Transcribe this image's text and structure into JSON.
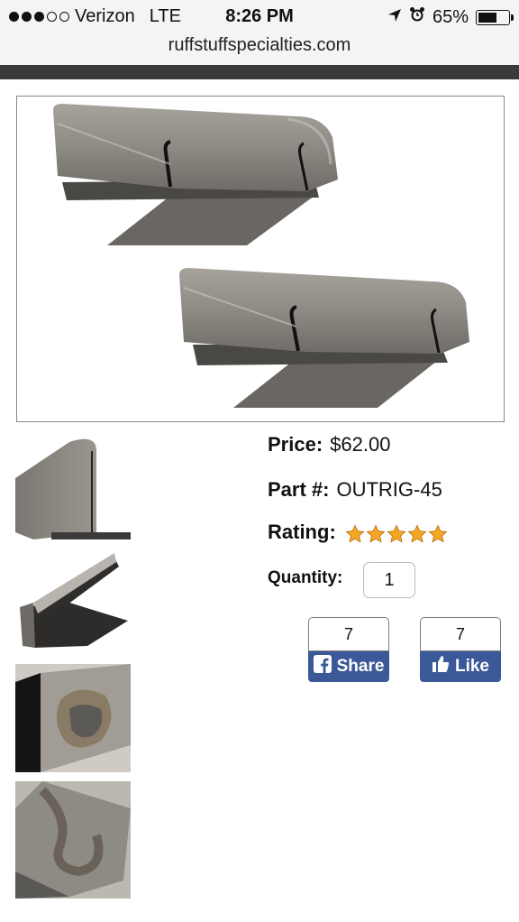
{
  "status_bar": {
    "carrier": "Verizon",
    "network": "LTE",
    "time": "8:26 PM",
    "battery": "65%",
    "battery_level": 0.65,
    "signal_bars_filled": 3,
    "signal_bars_total": 5,
    "icons": [
      "location-arrow-icon",
      "alarm-clock-icon",
      "battery-icon"
    ]
  },
  "browser": {
    "url": "ruffstuffspecialties.com"
  },
  "product": {
    "price_label": "Price:",
    "price_value": "$62.00",
    "part_label": "Part #:",
    "part_value": "OUTRIG-45",
    "rating_label": "Rating:",
    "rating_stars": 5,
    "rating_max": 5,
    "quantity_label": "Quantity:",
    "quantity_value": "1"
  },
  "social": {
    "share_count": "7",
    "share_label": "Share",
    "like_count": "7",
    "like_label": "Like"
  },
  "colors": {
    "facebook_blue": "#3b5998",
    "star_orange": "#f5a623",
    "header_dark": "#3a3a3a"
  }
}
